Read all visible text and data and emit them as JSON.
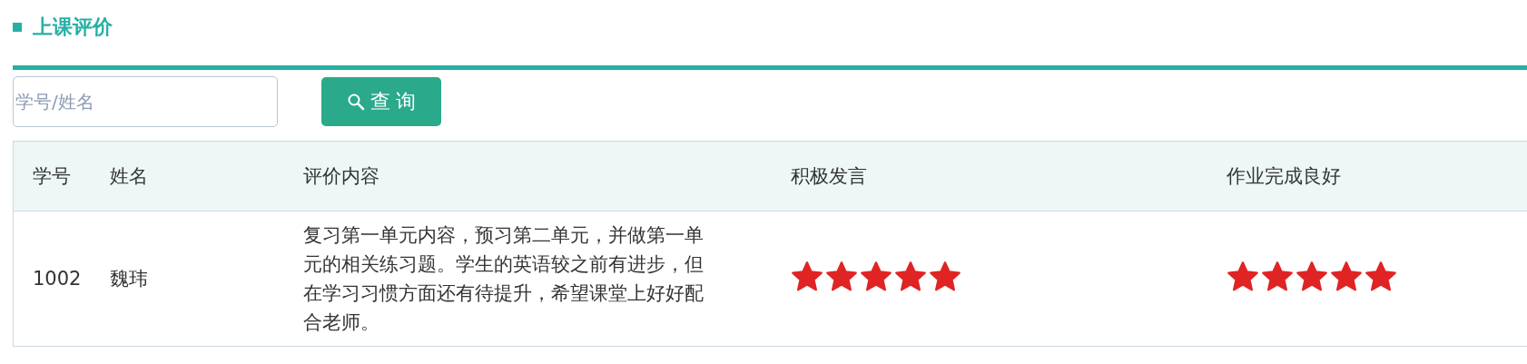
{
  "section_title": "上课评价",
  "search": {
    "placeholder": "学号/姓名",
    "button": "查 询"
  },
  "table": {
    "columns": [
      "学号",
      "姓名",
      "评价内容",
      "积极发言",
      "作业完成良好"
    ],
    "rows": [
      {
        "id": "1002",
        "name": "魏玮",
        "comment": "复习第一单元内容，预习第二单元，并做第一单元的相关练习题。学生的英语较之前有进步，但在学习习惯方面还有待提升，希望课堂上好好配合老师。",
        "ratings": [
          {
            "stars": 5
          },
          {
            "stars": 5
          }
        ]
      }
    ]
  }
}
